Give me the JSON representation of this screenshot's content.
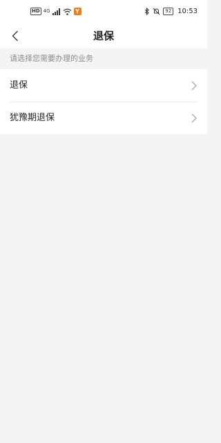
{
  "status_bar": {
    "left": {
      "hd": "HD",
      "signal": "4G",
      "hotspot": "Y"
    },
    "right": {
      "battery": "92",
      "time": "10:53"
    }
  },
  "header": {
    "title": "退保"
  },
  "hint": "请选择您需要办理的业务",
  "items": [
    {
      "label": "退保"
    },
    {
      "label": "犹豫期退保"
    }
  ],
  "icons": {
    "back": "chevron-left-icon",
    "item_arrow": "chevron-right-icon",
    "wifi": "wifi-icon",
    "signal": "signal-icon",
    "bluetooth": "bluetooth-icon",
    "mute": "bell-off-icon"
  },
  "colors": {
    "accent": "#f07b1d",
    "background": "#f4f4f4",
    "hint_text": "#8a8a8a"
  }
}
